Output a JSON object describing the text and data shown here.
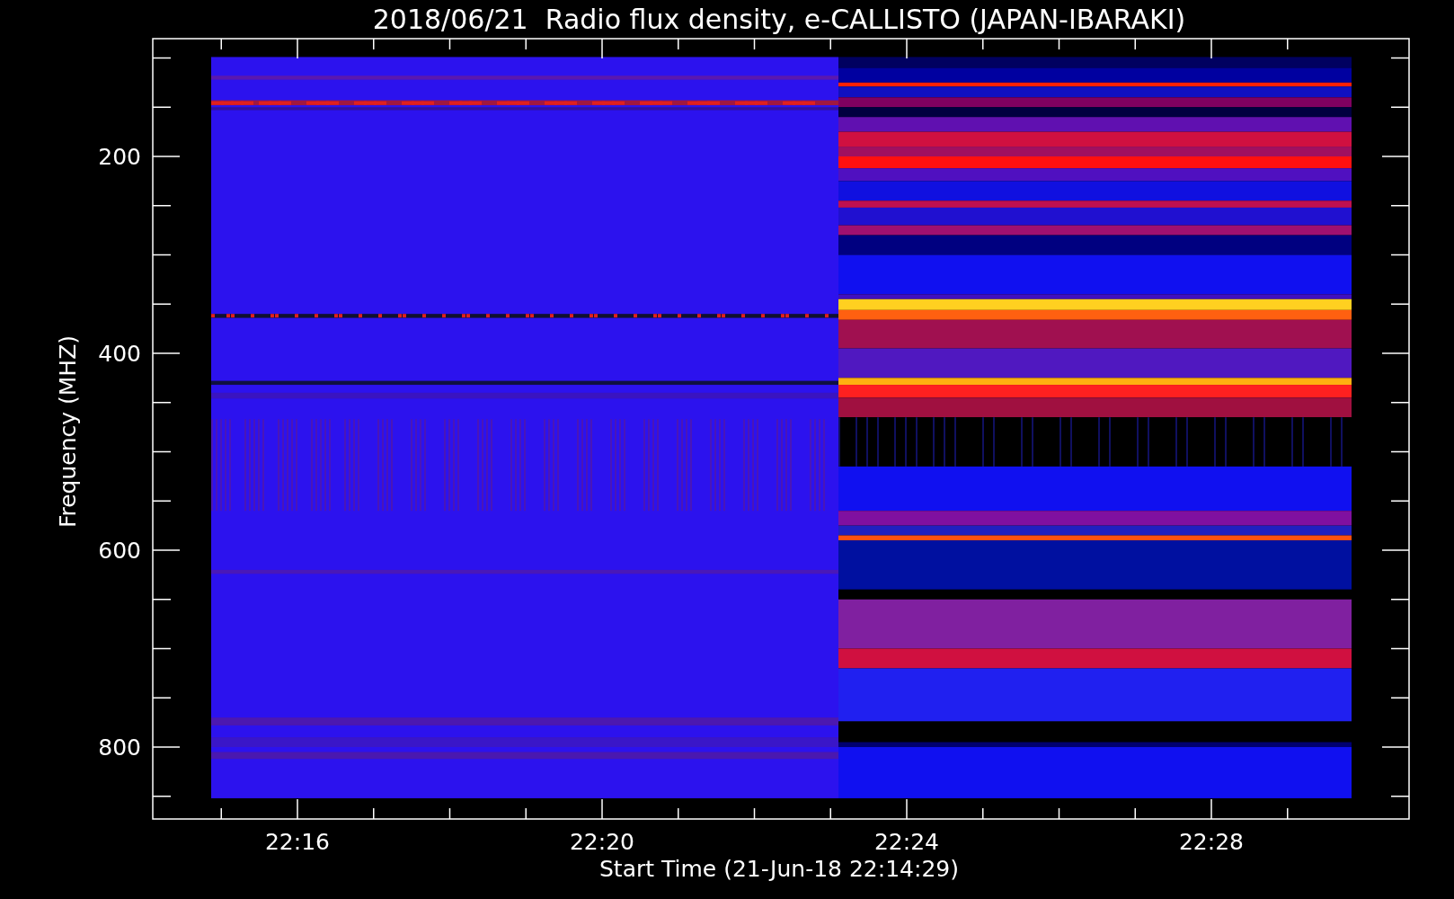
{
  "plot": {
    "title": "2018/06/21  Radio flux density, e-CALLISTO (JAPAN-IBARAKI)",
    "ylabel": "Frequency (MHZ)",
    "xlabel": "Start Time (21-Jun-18 22:14:29)",
    "ytick_labels": [
      "200",
      "400",
      "600",
      "800"
    ],
    "xtick_labels": [
      "22:16",
      "22:20",
      "22:24",
      "22:28"
    ]
  }
}
